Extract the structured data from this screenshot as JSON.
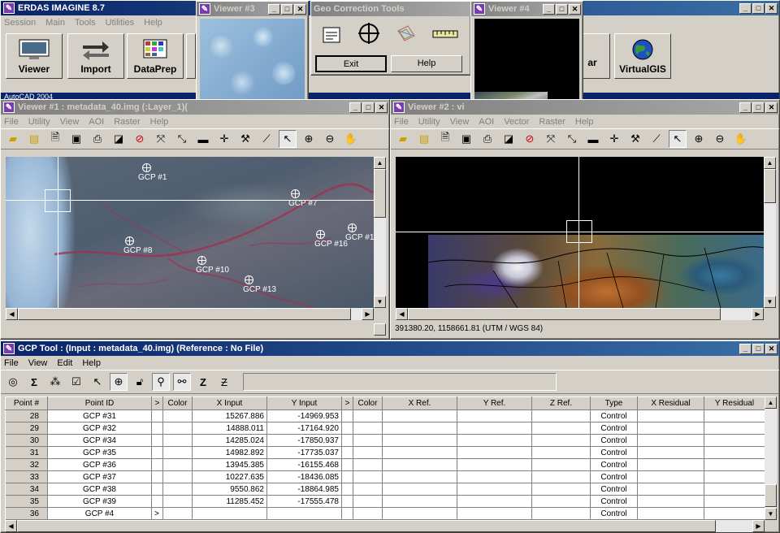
{
  "main": {
    "title": "ERDAS IMAGINE 8.7",
    "menu": [
      "Session",
      "Main",
      "Tools",
      "Utilities",
      "Help"
    ],
    "buttons": [
      "Viewer",
      "Import",
      "DataPrep",
      "ar",
      "VirtualGIS"
    ],
    "taskbar_text": "AutoCAD 2004"
  },
  "viewer3": {
    "title": "Viewer #3"
  },
  "viewer4": {
    "title": "Viewer #4"
  },
  "geo_tools": {
    "title": "Geo Correction Tools",
    "exit_label": "Exit",
    "help_label": "Help"
  },
  "viewer1": {
    "title": "Viewer #1 : metadata_40.img (:Layer_1)(",
    "menu": [
      "File",
      "Utility",
      "View",
      "AOI",
      "Raster",
      "Help"
    ],
    "gcps": [
      "GCP #1",
      "GCP #7",
      "GCP #8",
      "GCP #16",
      "GCP #1",
      "GCP #10",
      "GCP #13"
    ]
  },
  "viewer2": {
    "title": "Viewer #2 : vi",
    "menu": [
      "File",
      "Utility",
      "View",
      "AOI",
      "Vector",
      "Raster",
      "Help"
    ],
    "status": "391380.20, 1158661.81  (UTM / WGS 84)"
  },
  "gcp_tool": {
    "title": "GCP Tool : (Input : metadata_40.img) (Reference : No File)",
    "menu": [
      "File",
      "View",
      "Edit",
      "Help"
    ],
    "columns": [
      "Point #",
      "Point ID",
      ">",
      "Color",
      "X Input",
      "Y Input",
      ">",
      "Color",
      "X Ref.",
      "Y Ref.",
      "Z Ref.",
      "Type",
      "X Residual",
      "Y Residual"
    ],
    "rows": [
      {
        "num": "28",
        "id": "GCP #31",
        "mark": "",
        "x": "15267.886",
        "y": "-14969.953",
        "type": "Control"
      },
      {
        "num": "29",
        "id": "GCP #32",
        "mark": "",
        "x": "14888.011",
        "y": "-17164.920",
        "type": "Control"
      },
      {
        "num": "30",
        "id": "GCP #34",
        "mark": "",
        "x": "14285.024",
        "y": "-17850.937",
        "type": "Control"
      },
      {
        "num": "31",
        "id": "GCP #35",
        "mark": "",
        "x": "14982.892",
        "y": "-17735.037",
        "type": "Control"
      },
      {
        "num": "32",
        "id": "GCP #36",
        "mark": "",
        "x": "13945.385",
        "y": "-16155.468",
        "type": "Control"
      },
      {
        "num": "33",
        "id": "GCP #37",
        "mark": "",
        "x": "10227.635",
        "y": "-18436.085",
        "type": "Control"
      },
      {
        "num": "34",
        "id": "GCP #38",
        "mark": "",
        "x": "9550.862",
        "y": "-18864.985",
        "type": "Control"
      },
      {
        "num": "35",
        "id": "GCP #39",
        "mark": "",
        "x": "11285.452",
        "y": "-17555.478",
        "type": "Control"
      },
      {
        "num": "36",
        "id": "GCP #4",
        "mark": ">",
        "x": "",
        "y": "",
        "type": "Control"
      }
    ]
  }
}
